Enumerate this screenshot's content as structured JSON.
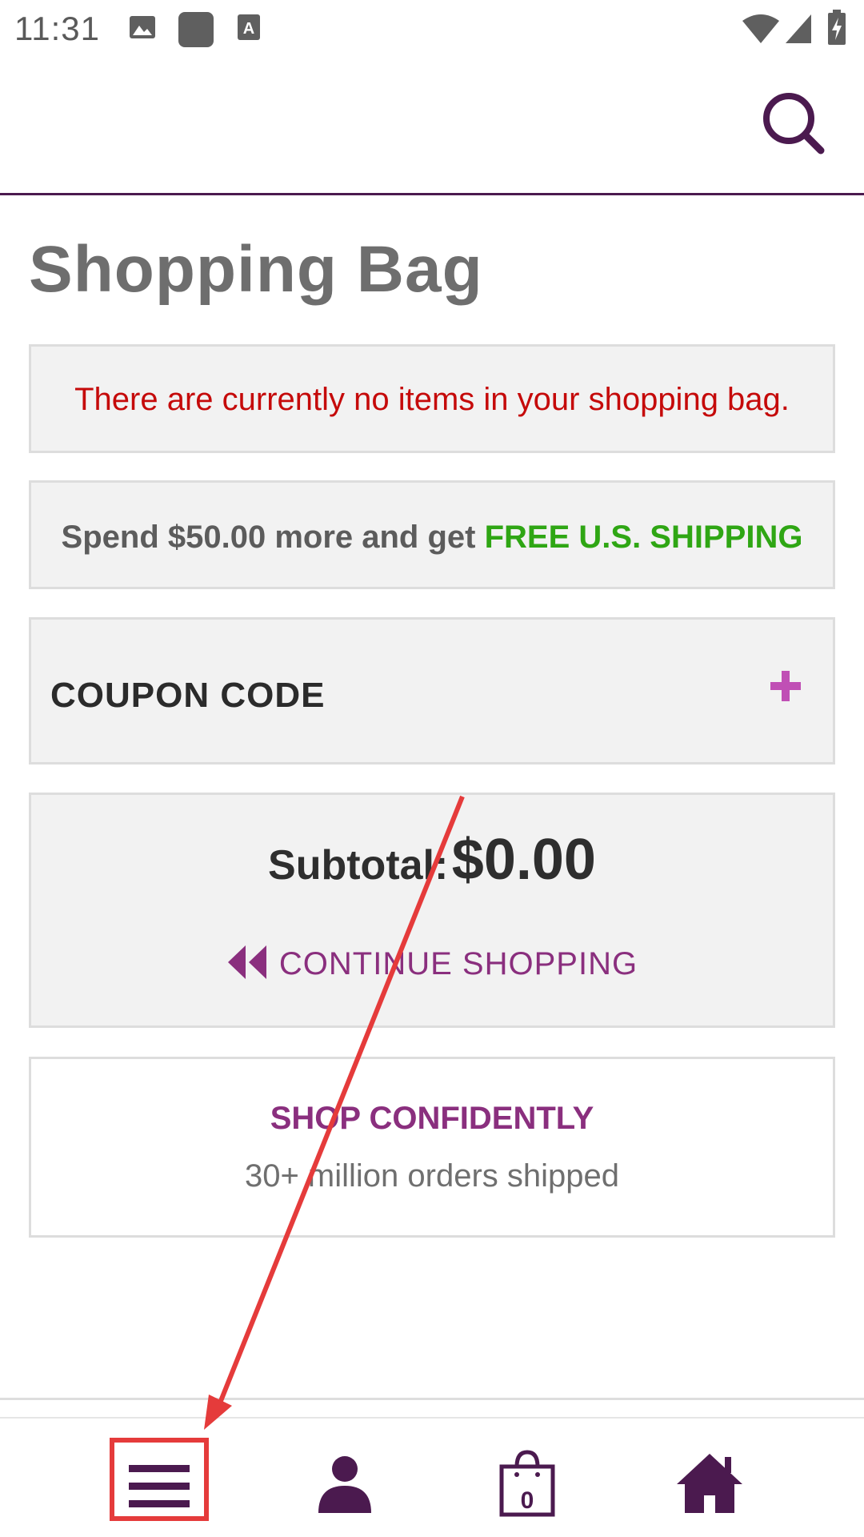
{
  "status_bar": {
    "time": "11:31"
  },
  "header": {
    "search_icon": "search-icon"
  },
  "page": {
    "title": "Shopping Bag",
    "empty_message": "There are currently no items in your shopping bag.",
    "shipping_prefix": "Spend $50.00 more and get ",
    "shipping_highlight": "FREE U.S. SHIPPING",
    "coupon_label": "COUPON CODE",
    "subtotal_label": "Subtotal:",
    "subtotal_value": "$0.00",
    "continue_label": "CONTINUE SHOPPING",
    "confident_title": "SHOP CONFIDENTLY",
    "confident_subtitle": "30+ million orders shipped"
  },
  "bottom_nav": {
    "items": [
      {
        "icon": "menu-icon"
      },
      {
        "icon": "account-icon"
      },
      {
        "icon": "bag-icon",
        "badge": "0"
      },
      {
        "icon": "home-icon"
      }
    ]
  },
  "colors": {
    "brand_purple": "#4b1a4f",
    "accent_magenta": "#8a2f7e",
    "error_red": "#c50a0a",
    "success_green": "#2fa614",
    "annotation_red": "#e53b3b"
  }
}
